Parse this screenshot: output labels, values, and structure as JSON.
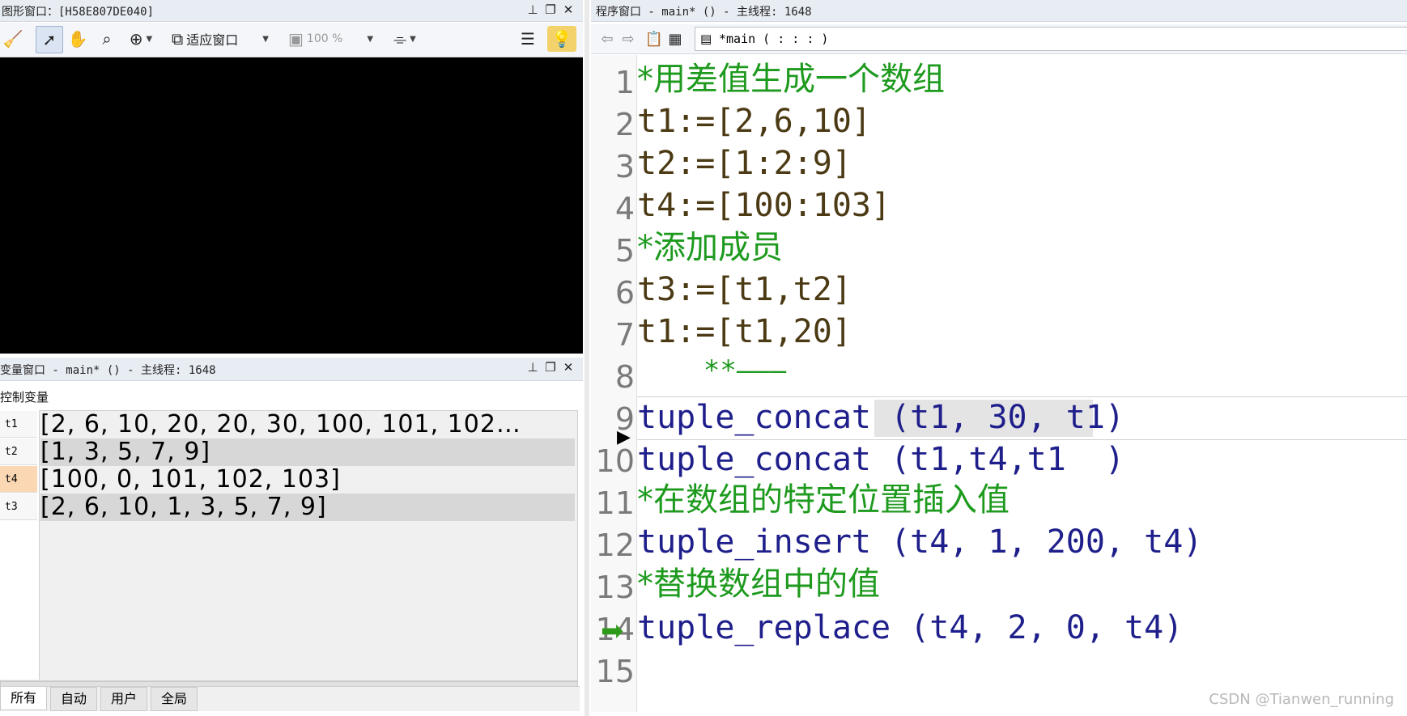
{
  "graphics_window": {
    "title": "图形窗口：[H58E807DE040]",
    "fit_label": "适应窗口",
    "zoom": "100 %",
    "icons": [
      "broom-icon",
      "pointer-icon",
      "hand-icon",
      "zoom-out-icon",
      "zoom-in-icon",
      "fit-window-icon",
      "zoom-percent-icon",
      "shape-icon",
      "layers-icon",
      "bulb-icon"
    ]
  },
  "variable_window": {
    "title": "变量窗口 - main* () - 主线程: 1648",
    "section": "控制变量",
    "rows": [
      {
        "name": "t1",
        "value": "[2, 6, 10, 20, 20, 30, 100, 101, 102…",
        "highlight": false
      },
      {
        "name": "t2",
        "value": "[1, 3, 5, 7, 9]",
        "highlight": false
      },
      {
        "name": "t4",
        "value": "[100, 0, 101, 102, 103]",
        "highlight": true
      },
      {
        "name": "t3",
        "value": "[2, 6, 10, 1, 3, 5, 7, 9]",
        "highlight": false
      }
    ],
    "tabs": [
      "所有",
      "自动",
      "用户",
      "全局"
    ]
  },
  "program_window": {
    "title": "程序窗口 - main* () - 主线程: 1648",
    "procedure": "*main ( : : : )",
    "lines": [
      {
        "n": "1",
        "text": "*用差值生成一个数组",
        "color": "green"
      },
      {
        "n": "2",
        "text": "t1:=[2,6,10]",
        "color": "brown"
      },
      {
        "n": "3",
        "text": "t2:=[1:2:9]",
        "color": "brown"
      },
      {
        "n": "4",
        "text": "t4:=[100:103]",
        "color": "brown"
      },
      {
        "n": "5",
        "text": "*添加成员",
        "color": "green"
      },
      {
        "n": "6",
        "text": "t3:=[t1,t2]",
        "color": "brown"
      },
      {
        "n": "7",
        "text": "t1:=[t1,20]",
        "color": "brown"
      },
      {
        "n": "8",
        "text": "    **———",
        "color": "green"
      },
      {
        "n": "9",
        "text": "tuple_concat (t1, 30, t1)",
        "color": "blue"
      },
      {
        "n": "10",
        "text": "tuple_concat (t1,t4,t1  )",
        "color": "blue"
      },
      {
        "n": "11",
        "text": "*在数组的特定位置插入值",
        "color": "green"
      },
      {
        "n": "12",
        "text": "tuple_insert (t4, 1, 200, t4)",
        "color": "blue"
      },
      {
        "n": "13",
        "text": "*替换数组中的值",
        "color": "green"
      },
      {
        "n": "14",
        "text": "tuple_replace (t4, 2, 0, t4)",
        "color": "blue"
      },
      {
        "n": "15",
        "text": "",
        "color": "blue"
      }
    ]
  },
  "watermark": "CSDN @Tianwen_running"
}
